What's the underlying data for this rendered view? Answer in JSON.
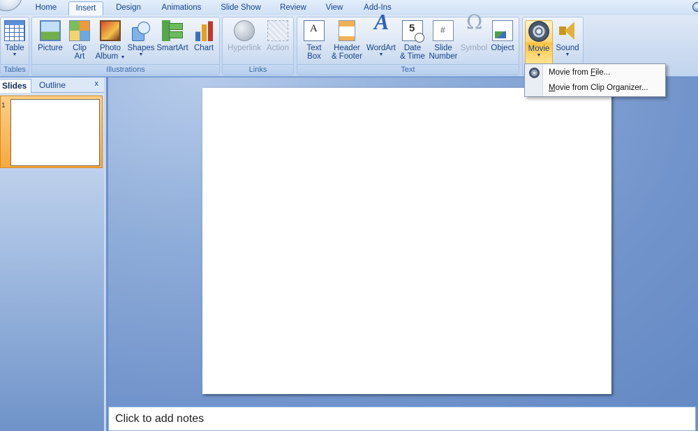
{
  "ribbon_tabs": [
    "Home",
    "Insert",
    "Design",
    "Animations",
    "Slide Show",
    "Review",
    "View",
    "Add-Ins"
  ],
  "active_tab": "Insert",
  "groups": {
    "tables": "Tables",
    "illustrations": "Illustrations",
    "links": "Links",
    "text": "Text"
  },
  "buttons": {
    "table": {
      "line1": "Table",
      "icon": "table-icon"
    },
    "picture": {
      "line1": "Picture",
      "icon": "picture-icon"
    },
    "clip_art": {
      "line1": "Clip",
      "line2": "Art",
      "icon": "clip-art-icon"
    },
    "photo_album": {
      "line1": "Photo",
      "line2": "Album",
      "icon": "photo-album-icon"
    },
    "shapes": {
      "line1": "Shapes",
      "icon": "shapes-icon"
    },
    "smartart": {
      "line1": "SmartArt",
      "icon": "smartart-icon"
    },
    "chart": {
      "line1": "Chart",
      "icon": "chart-icon"
    },
    "hyperlink": {
      "line1": "Hyperlink",
      "icon": "hyperlink-icon"
    },
    "action": {
      "line1": "Action",
      "icon": "action-icon"
    },
    "text_box": {
      "line1": "Text",
      "line2": "Box",
      "icon": "text-box-icon"
    },
    "header_footer": {
      "line1": "Header",
      "line2": "& Footer",
      "icon": "header-footer-icon"
    },
    "wordart": {
      "line1": "WordArt",
      "icon": "wordart-icon"
    },
    "date_time": {
      "line1": "Date",
      "line2": "& Time",
      "icon": "date-time-icon"
    },
    "slide_number": {
      "line1": "Slide",
      "line2": "Number",
      "icon": "slide-number-icon"
    },
    "symbol": {
      "line1": "Symbol",
      "icon": "omega-icon"
    },
    "object": {
      "line1": "Object",
      "icon": "object-icon"
    },
    "movie": {
      "line1": "Movie",
      "icon": "film-reel-icon"
    },
    "sound": {
      "line1": "Sound",
      "icon": "speaker-icon"
    }
  },
  "movie_menu": {
    "items": [
      {
        "pre": "Movie from ",
        "key": "F",
        "post": "ile..."
      },
      {
        "pre": "",
        "key": "M",
        "post": "ovie from Clip Organizer..."
      }
    ]
  },
  "slide_pane": {
    "tabs": [
      "Slides",
      "Outline"
    ],
    "close": "x",
    "slide_number": "1"
  },
  "notes": {
    "placeholder": "Click to add notes"
  },
  "colors": {
    "ribbon": "#cddcf1",
    "workspace": "#7294cc",
    "highlight": "#ffc341",
    "selected_thumb": "#f5a93c"
  }
}
